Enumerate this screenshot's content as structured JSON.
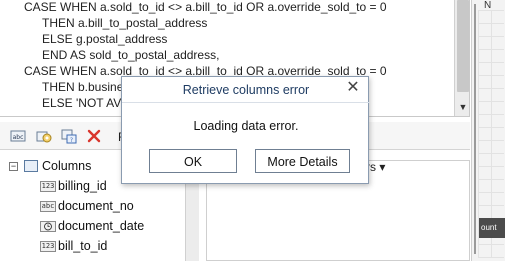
{
  "editor": {
    "lines": [
      "CASE WHEN a.sold_to_id <> a.bill_to_id OR a.override_sold_to = 0",
      "THEN a.bill_to_postal_address",
      "ELSE g.postal_address",
      "END AS sold_to_postal_address,",
      "CASE WHEN a.sold_to_id <> a.bill_to_id OR a.override_sold_to = 0",
      "THEN b.business_address",
      "ELSE 'NOT AV"
    ]
  },
  "toolbar": {
    "label": "R"
  },
  "tree": {
    "root_label": "Columns",
    "items": [
      {
        "type_icon": "123",
        "label": "billing_id"
      },
      {
        "type_icon": "abc",
        "label": "document_no"
      },
      {
        "type_icon": "clock",
        "label": "document_date"
      },
      {
        "type_icon": "123",
        "label": "bill_to_id"
      }
    ]
  },
  "right_panel": {
    "label": "cters ▾",
    "strip_header": "N",
    "strip_dark": "ount"
  },
  "dialog": {
    "title": "Retrieve columns error",
    "message": "Loading data error.",
    "ok_label": "OK",
    "details_label": "More Details"
  },
  "colors": {
    "dialog_title": "#1f3c63",
    "dialog_border": "#8a9bb0",
    "delete_icon": "#d9352c"
  }
}
